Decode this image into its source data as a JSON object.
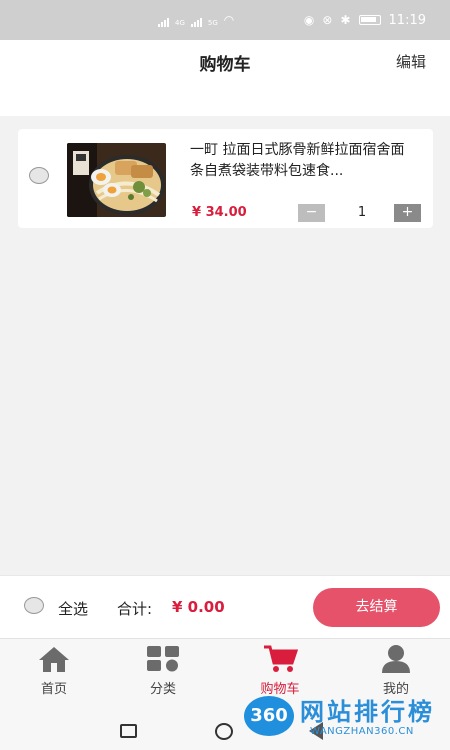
{
  "status_bar": {
    "time": "11:19",
    "net_1": "4G",
    "net_2": "5G"
  },
  "header": {
    "title": "购物车",
    "edit_label": "编辑"
  },
  "cart": {
    "items": [
      {
        "name": "一町 拉面日式豚骨新鲜拉面宿舍面条自煮袋装带料包速食...",
        "price": "¥ 34.00",
        "quantity": "1",
        "minus_label": "−",
        "plus_label": "+"
      }
    ]
  },
  "checkout": {
    "select_all_label": "全选",
    "total_label": "合计:",
    "total_value": "¥ 0.00",
    "checkout_label": "去结算"
  },
  "tabbar": {
    "tabs": [
      {
        "label": "首页",
        "icon": "home-icon"
      },
      {
        "label": "分类",
        "icon": "category-icon"
      },
      {
        "label": "购物车",
        "icon": "cart-icon",
        "active": true
      },
      {
        "label": "我的",
        "icon": "user-icon"
      }
    ],
    "active_color": "#d81e3c"
  },
  "watermark": {
    "logo_text": "360",
    "title": "网站排行榜",
    "subtitle": "WANGZHAN360.CN"
  },
  "colors": {
    "accent": "#d81e3c",
    "checkout_button": "#e65269"
  }
}
